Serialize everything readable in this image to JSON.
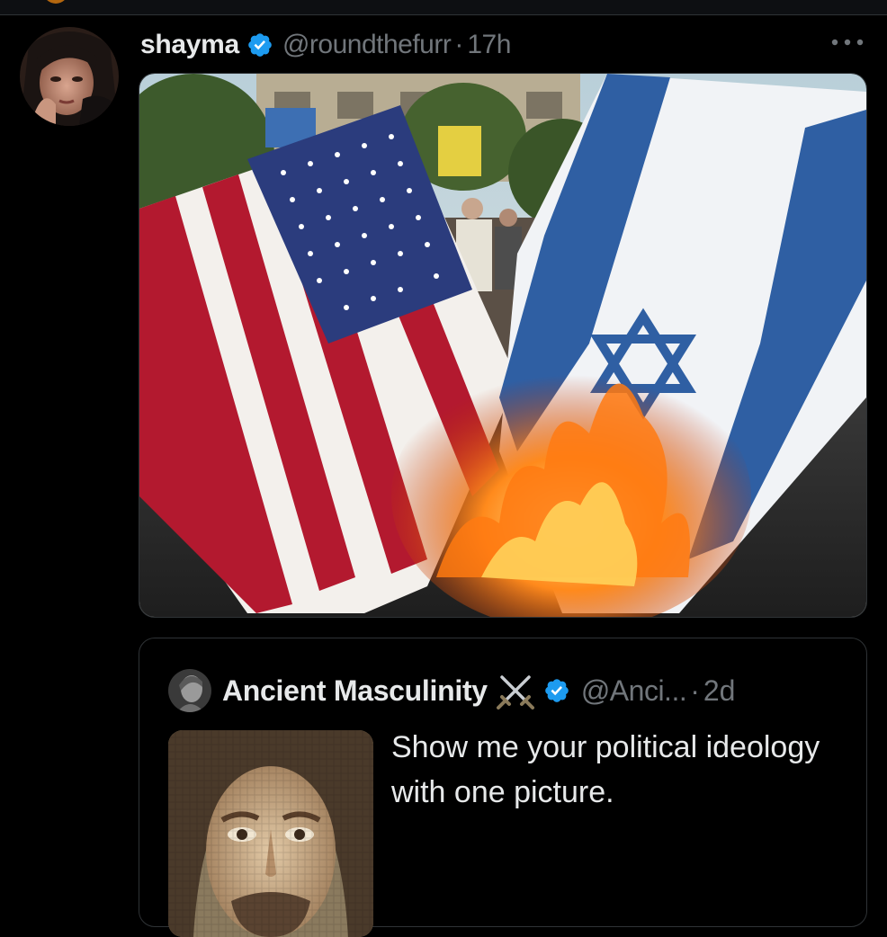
{
  "post": {
    "author_name": "shayma",
    "handle": "@roundthefurr",
    "separator": "·",
    "time": "17h"
  },
  "quoted_post": {
    "author_name": "Ancient Masculinity",
    "handle": "@Anci...",
    "separator": "·",
    "time": "2d",
    "text": "Show me your political ideology with one picture."
  },
  "colors": {
    "background": "#000000",
    "verified_badge": "#1d9bf0",
    "text_primary": "#e7e9ea",
    "text_secondary": "#71767b",
    "border": "#2f3336"
  },
  "icons": {
    "verified": "verified-badge-icon",
    "more": "more-options-icon",
    "swords": "crossed-swords-icon"
  }
}
